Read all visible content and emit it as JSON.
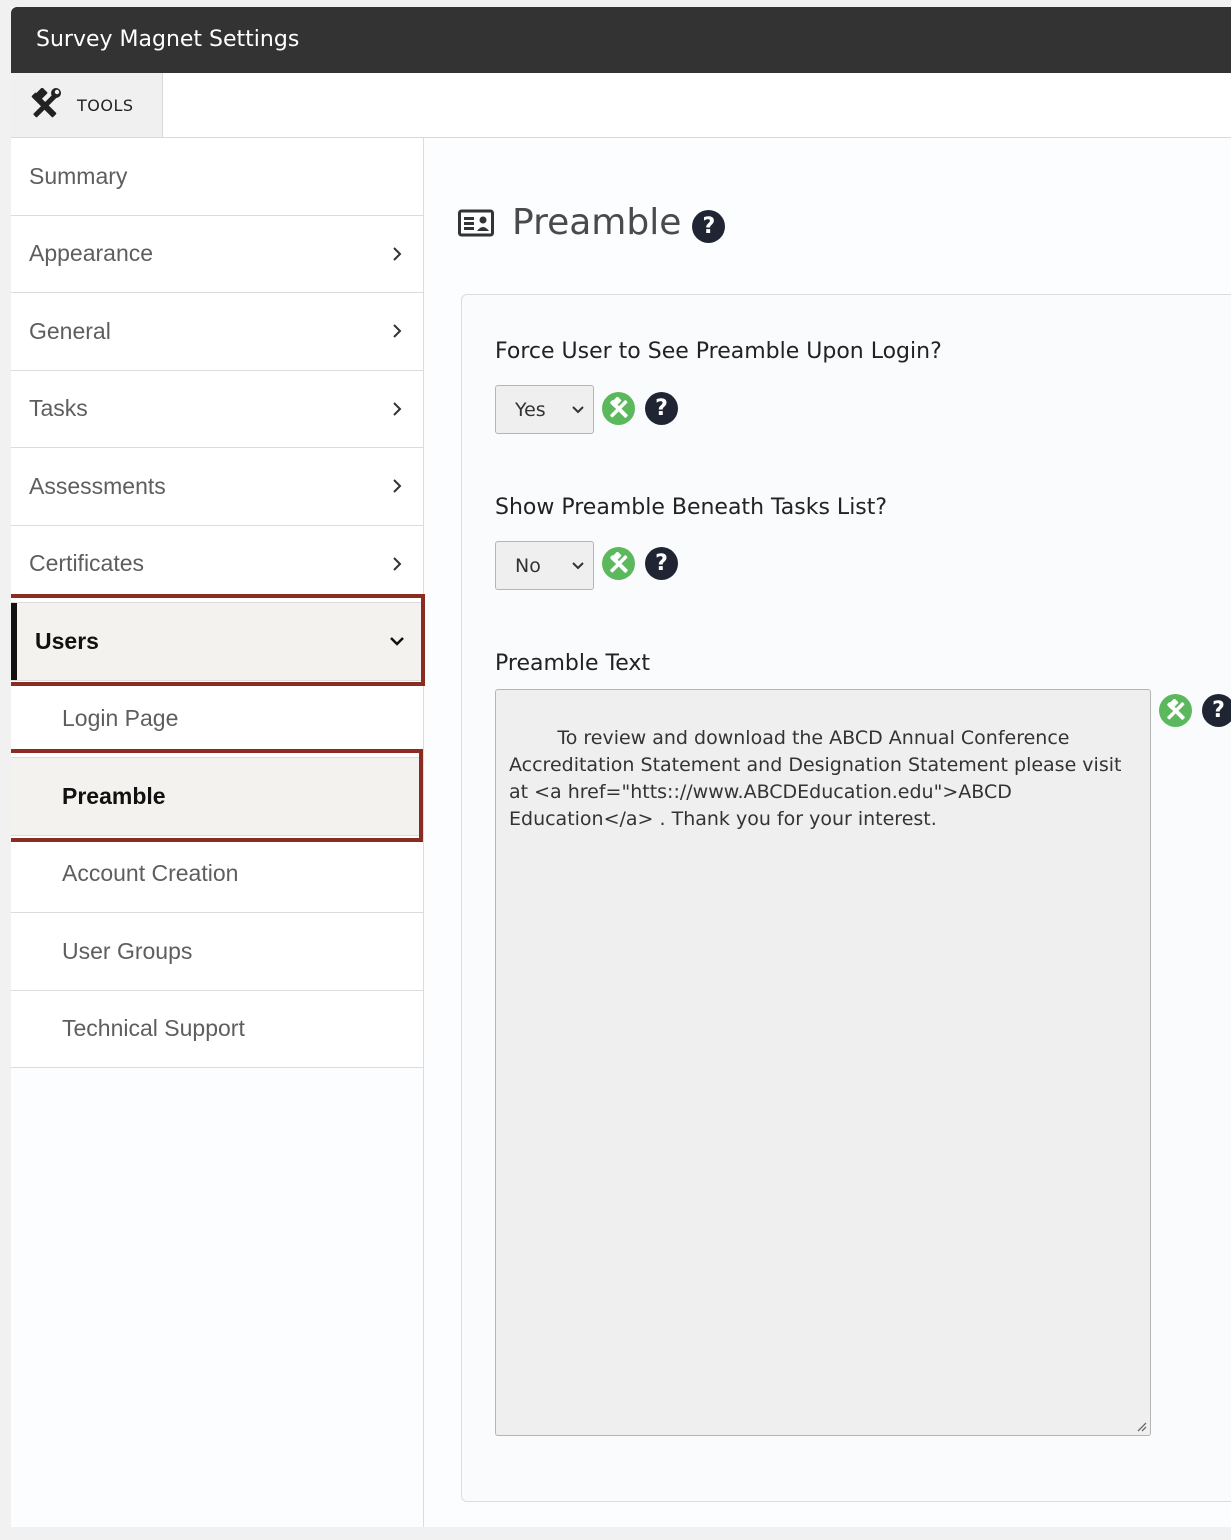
{
  "window": {
    "title": "Survey Magnet Settings"
  },
  "toolbar": {
    "tools_label": "TOOLS"
  },
  "sidebar": {
    "items": [
      {
        "label": "Summary"
      },
      {
        "label": "Appearance"
      },
      {
        "label": "General"
      },
      {
        "label": "Tasks"
      },
      {
        "label": "Assessments"
      },
      {
        "label": "Certificates"
      },
      {
        "label": "Users"
      }
    ],
    "subitems": [
      {
        "label": "Login Page"
      },
      {
        "label": "Preamble"
      },
      {
        "label": "Account Creation"
      },
      {
        "label": "User Groups"
      },
      {
        "label": "Technical Support"
      }
    ]
  },
  "main": {
    "title": "Preamble",
    "help_glyph": "?",
    "fields": {
      "force": {
        "label": "Force User to See Preamble Upon Login?",
        "value": "Yes"
      },
      "beneath": {
        "label": "Show Preamble Beneath Tasks List?",
        "value": "No"
      },
      "text": {
        "label": "Preamble Text",
        "value": "To review and download the ABCD Annual Conference Accreditation Statement and Designation Statement please visit at <a href=\"htts:://www.ABCDEducation.edu\">ABCD Education</a> . Thank you for your interest."
      }
    }
  },
  "colors": {
    "highlight": "#8b2c22",
    "wrench_green": "#5cb85c",
    "titlebar": "#333333",
    "help_bg": "#1f2533"
  },
  "icons": [
    "tools-icon",
    "chevron-right-icon",
    "chevron-down-icon",
    "id-card-icon",
    "help-icon",
    "wrench-icon"
  ]
}
